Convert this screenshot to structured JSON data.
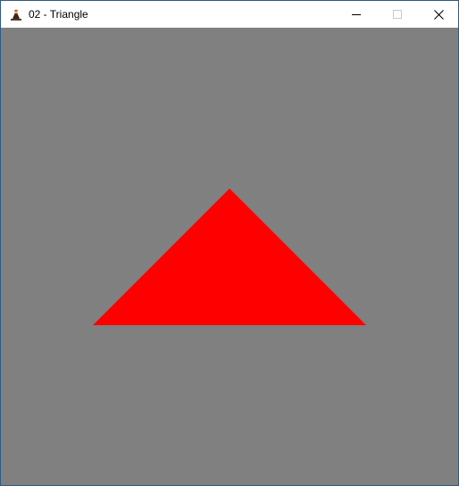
{
  "window": {
    "title": "02 - Triangle",
    "app_icon": "volcano-app-icon",
    "controls": {
      "minimize_icon": "minimize-icon",
      "maximize_icon": "maximize-icon",
      "close_icon": "close-icon"
    }
  },
  "viewport": {
    "clear_color": "#808080",
    "triangle": {
      "fill_color": "#ff0000"
    }
  }
}
